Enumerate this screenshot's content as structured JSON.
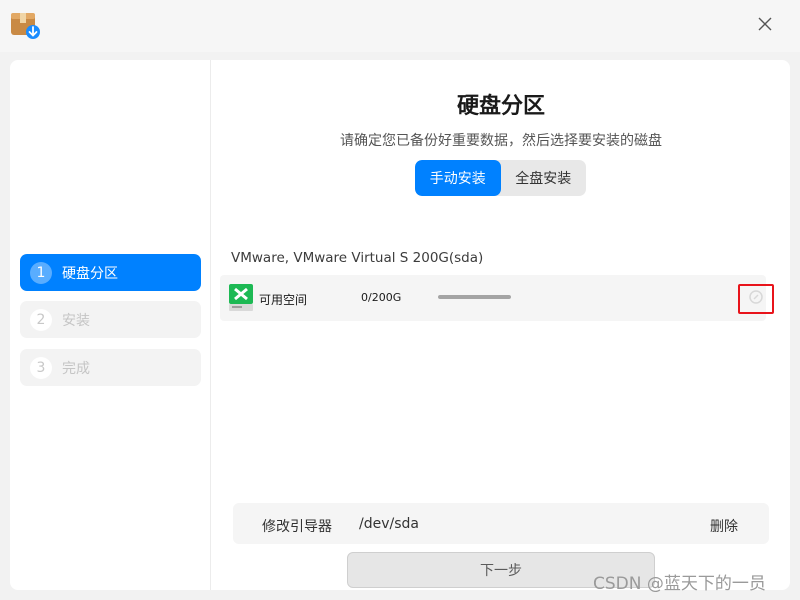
{
  "titlebar": {
    "app_icon": "package-download-icon",
    "close_icon": "close-icon"
  },
  "sidebar": {
    "steps": [
      {
        "number": "1",
        "label": "硬盘分区",
        "state": "active"
      },
      {
        "number": "2",
        "label": "安装",
        "state": "inactive"
      },
      {
        "number": "3",
        "label": "完成",
        "state": "inactive"
      }
    ]
  },
  "main": {
    "title": "硬盘分区",
    "subtitle": "请确定您已备份好重要数据，然后选择要安装的磁盘",
    "modes": [
      {
        "label": "手动安装",
        "selected": true
      },
      {
        "label": "全盘安装",
        "selected": false
      }
    ],
    "disk_name": "VMware, VMware Virtual S 200G(sda)",
    "partitions": [
      {
        "icon": "free-space-icon",
        "name": "可用空间",
        "size": "0/200G",
        "usage_fraction": 1.0,
        "edit_icon": "edit-icon"
      }
    ],
    "boot_loader": {
      "label": "修改引导器",
      "value": "/dev/sda",
      "delete_label": "删除"
    },
    "next_label": "下一步"
  },
  "watermark": "CSDN @蓝天下的一员",
  "colors": {
    "accent": "#0081ff",
    "highlight_border": "#e8141b",
    "free_space_green": "#1db954"
  }
}
